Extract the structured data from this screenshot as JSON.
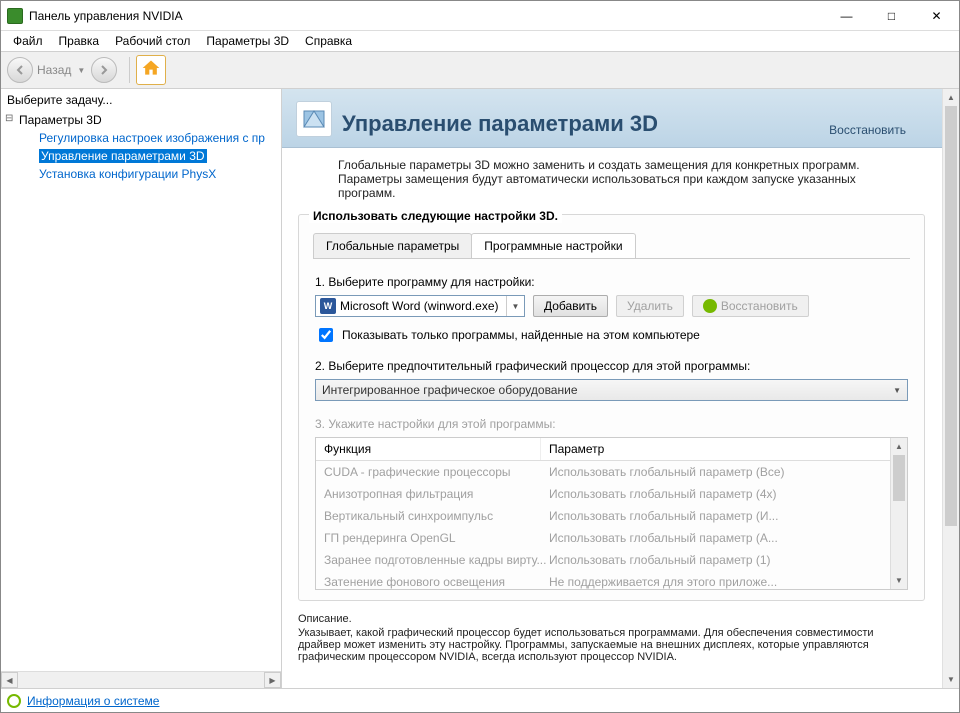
{
  "window": {
    "title": "Панель управления NVIDIA"
  },
  "menu": {
    "file": "Файл",
    "edit": "Правка",
    "desktop": "Рабочий стол",
    "params3d": "Параметры 3D",
    "help": "Справка"
  },
  "toolbar": {
    "back_label": "Назад"
  },
  "sidebar": {
    "task_label": "Выберите задачу...",
    "root": "Параметры 3D",
    "items": [
      {
        "label": "Регулировка настроек изображения с пр"
      },
      {
        "label": "Управление параметрами 3D"
      },
      {
        "label": "Установка конфигурации PhysX"
      }
    ]
  },
  "header": {
    "title": "Управление параметрами 3D",
    "restore": "Восстановить"
  },
  "description": "Глобальные параметры 3D можно заменить и создать замещения для конкретных программ. Параметры замещения будут автоматически использоваться при каждом запуске указанных программ.",
  "group": {
    "title": "Использовать следующие настройки 3D.",
    "tabs": {
      "global": "Глобальные параметры",
      "program": "Программные настройки"
    },
    "step1": "1. Выберите программу для настройки:",
    "program_name": "Microsoft Word (winword.exe)",
    "program_icon_letter": "W",
    "btn_add": "Добавить",
    "btn_remove": "Удалить",
    "btn_restore": "Восстановить",
    "checkbox_text": "Показывать только программы, найденные на этом компьютере",
    "step2": "2. Выберите предпочтительный графический процессор для этой программы:",
    "gpu_choice": "Интегрированное графическое оборудование",
    "step3": "3. Укажите настройки для этой программы:",
    "col_function": "Функция",
    "col_param": "Параметр",
    "rows": [
      {
        "f": "CUDA - графические процессоры",
        "p": "Использовать глобальный параметр (Все)"
      },
      {
        "f": "Анизотропная фильтрация",
        "p": "Использовать глобальный параметр (4x)"
      },
      {
        "f": "Вертикальный синхроимпульс",
        "p": "Использовать глобальный параметр (И..."
      },
      {
        "f": "ГП рендеринга OpenGL",
        "p": "Использовать глобальный параметр (А..."
      },
      {
        "f": "Заранее подготовленные кадры вирту...",
        "p": "Использовать глобальный параметр (1)"
      },
      {
        "f": "Затенение фонового освещения",
        "p": "Не поддерживается для этого приложе..."
      }
    ]
  },
  "footer": {
    "title": "Описание.",
    "text": "Указывает, какой графический процессор будет использоваться программами. Для обеспечения совместимости драйвер может изменить эту настройку. Программы, запускаемые на внешних дисплеях, которые управляются графическим процессором NVIDIA, всегда используют процессор NVIDIA."
  },
  "status": {
    "link": "Информация о системе"
  }
}
